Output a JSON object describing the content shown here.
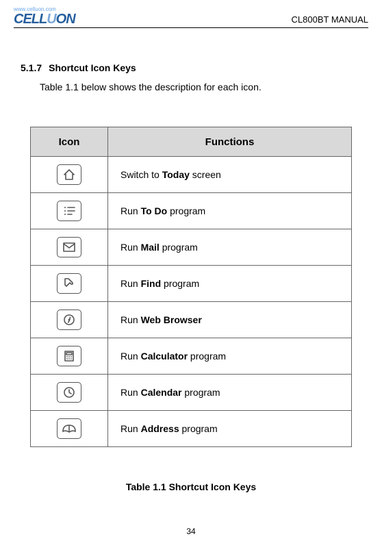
{
  "header": {
    "url": "www.celluon.com",
    "brand_a": "CELL",
    "brand_b": "U",
    "brand_c": "ON",
    "title": "CL800BT MANUAL"
  },
  "section": {
    "number": "5.1.7",
    "title": "Shortcut Icon Keys",
    "intro": "Table 1.1 below shows the description for each icon."
  },
  "table": {
    "col_icon": "Icon",
    "col_func": "Functions",
    "rows": [
      {
        "icon": "home",
        "pre": "Switch to ",
        "bold": "Today",
        "post": " screen"
      },
      {
        "icon": "todo",
        "pre": "Run ",
        "bold": "To Do",
        "post": " program"
      },
      {
        "icon": "mail",
        "pre": "Run   ",
        "bold": "Mail",
        "post": " program"
      },
      {
        "icon": "find",
        "pre": "Run   ",
        "bold": "Find",
        "post": " program"
      },
      {
        "icon": "web",
        "pre": "Run   ",
        "bold": "Web Browser",
        "post": ""
      },
      {
        "icon": "calculator",
        "pre": "Run   ",
        "bold": "Calculator",
        "post": " program"
      },
      {
        "icon": "calendar",
        "pre": "Run   ",
        "bold": "Calendar",
        "post": " program"
      },
      {
        "icon": "address",
        "pre": "Run   ",
        "bold": "Address",
        "post": " program"
      }
    ]
  },
  "caption": "Table 1.1 Shortcut Icon Keys",
  "page_number": "34"
}
